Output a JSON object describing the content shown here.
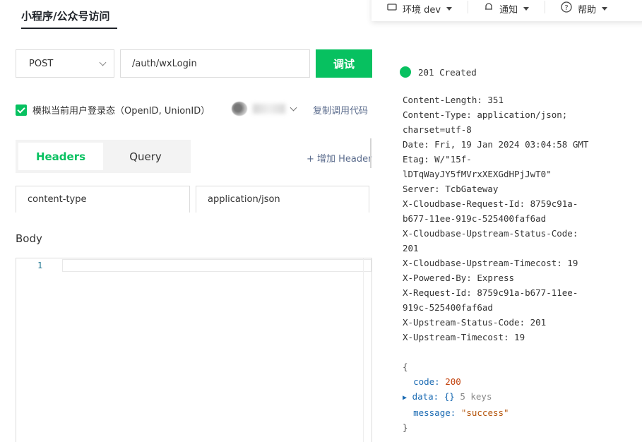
{
  "toolbar": {
    "env_label": "环境 dev",
    "notify_label": "通知",
    "help_label": "帮助",
    "icons": [
      "environment-icon",
      "bell-icon",
      "help-circle-icon"
    ]
  },
  "page": {
    "title": "小程序/公众号访问"
  },
  "request": {
    "method": "POST",
    "path": "/auth/wxLogin",
    "debug_label": "调试",
    "simulate_label": "模拟当前用户登录态（OpenID, UnionID）",
    "simulate_checked": true,
    "copy_code_label": "复制调用代码"
  },
  "tabs": [
    {
      "label": "Headers",
      "active": true
    },
    {
      "label": "Query",
      "active": false
    }
  ],
  "add_header_label": "+ 增加 Header",
  "headers_row": {
    "key": "content-type",
    "value": "application/json"
  },
  "body": {
    "label": "Body",
    "line_number": "1"
  },
  "response": {
    "status": "201 Created",
    "status_color": "#07c160",
    "header_lines": [
      "Content-Length: 351",
      "Content-Type: application/json;",
      "charset=utf-8",
      "Date: Fri, 19 Jan 2024 03:04:58 GMT",
      "Etag: W/\"15f-",
      "lDTqWayJY5fMVrxXEXGdHPjJwT0\"",
      "Server: TcbGateway",
      "X-Cloudbase-Request-Id: 8759c91a-",
      "b677-11ee-919c-525400faf6ad",
      "X-Cloudbase-Upstream-Status-Code:",
      "201",
      "X-Cloudbase-Upstream-Timecost: 19",
      "X-Powered-By: Express",
      "X-Request-Id: 8759c91a-b677-11ee-",
      "919c-525400faf6ad",
      "X-Upstream-Status-Code: 201",
      "X-Upstream-Timecost: 19"
    ],
    "json": {
      "open": "{",
      "close": "}",
      "code_key": "code:",
      "code_value": "200",
      "data_key": "data:",
      "data_value": "{}",
      "data_meta": "5 keys",
      "message_key": "message:",
      "message_value": "\"success\""
    }
  },
  "colors": {
    "accent": "#07c160",
    "link": "#5a6b8c"
  }
}
